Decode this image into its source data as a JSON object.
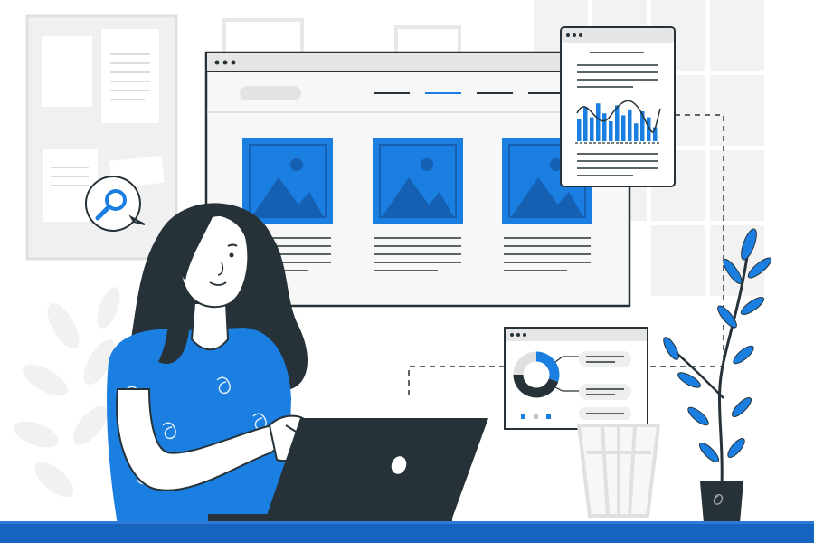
{
  "colors": {
    "accent": "#1a7fe0",
    "accent_dark": "#1560b3",
    "dark": "#263238",
    "light_gray": "#f5f5f5",
    "mid_gray": "#e0e0e0",
    "line_gray": "#c7c7c7",
    "floor_blue": "#1565c0"
  },
  "illustration": {
    "subject": "woman-using-laptop",
    "icons": [
      "search-icon",
      "image-placeholder-icon",
      "bar-chart-icon",
      "donut-chart-icon",
      "plant-icon",
      "apple-logo-icon"
    ]
  },
  "browser_window": {
    "image_cards": 3
  },
  "report_popup": {
    "bars": [
      0.55,
      0.85,
      0.6,
      0.95,
      0.7,
      0.5,
      0.9,
      0.65,
      0.8,
      0.45,
      0.75,
      0.6,
      0.35
    ]
  },
  "donut_panel": {
    "segments": [
      0.3,
      0.45,
      0.25
    ]
  }
}
